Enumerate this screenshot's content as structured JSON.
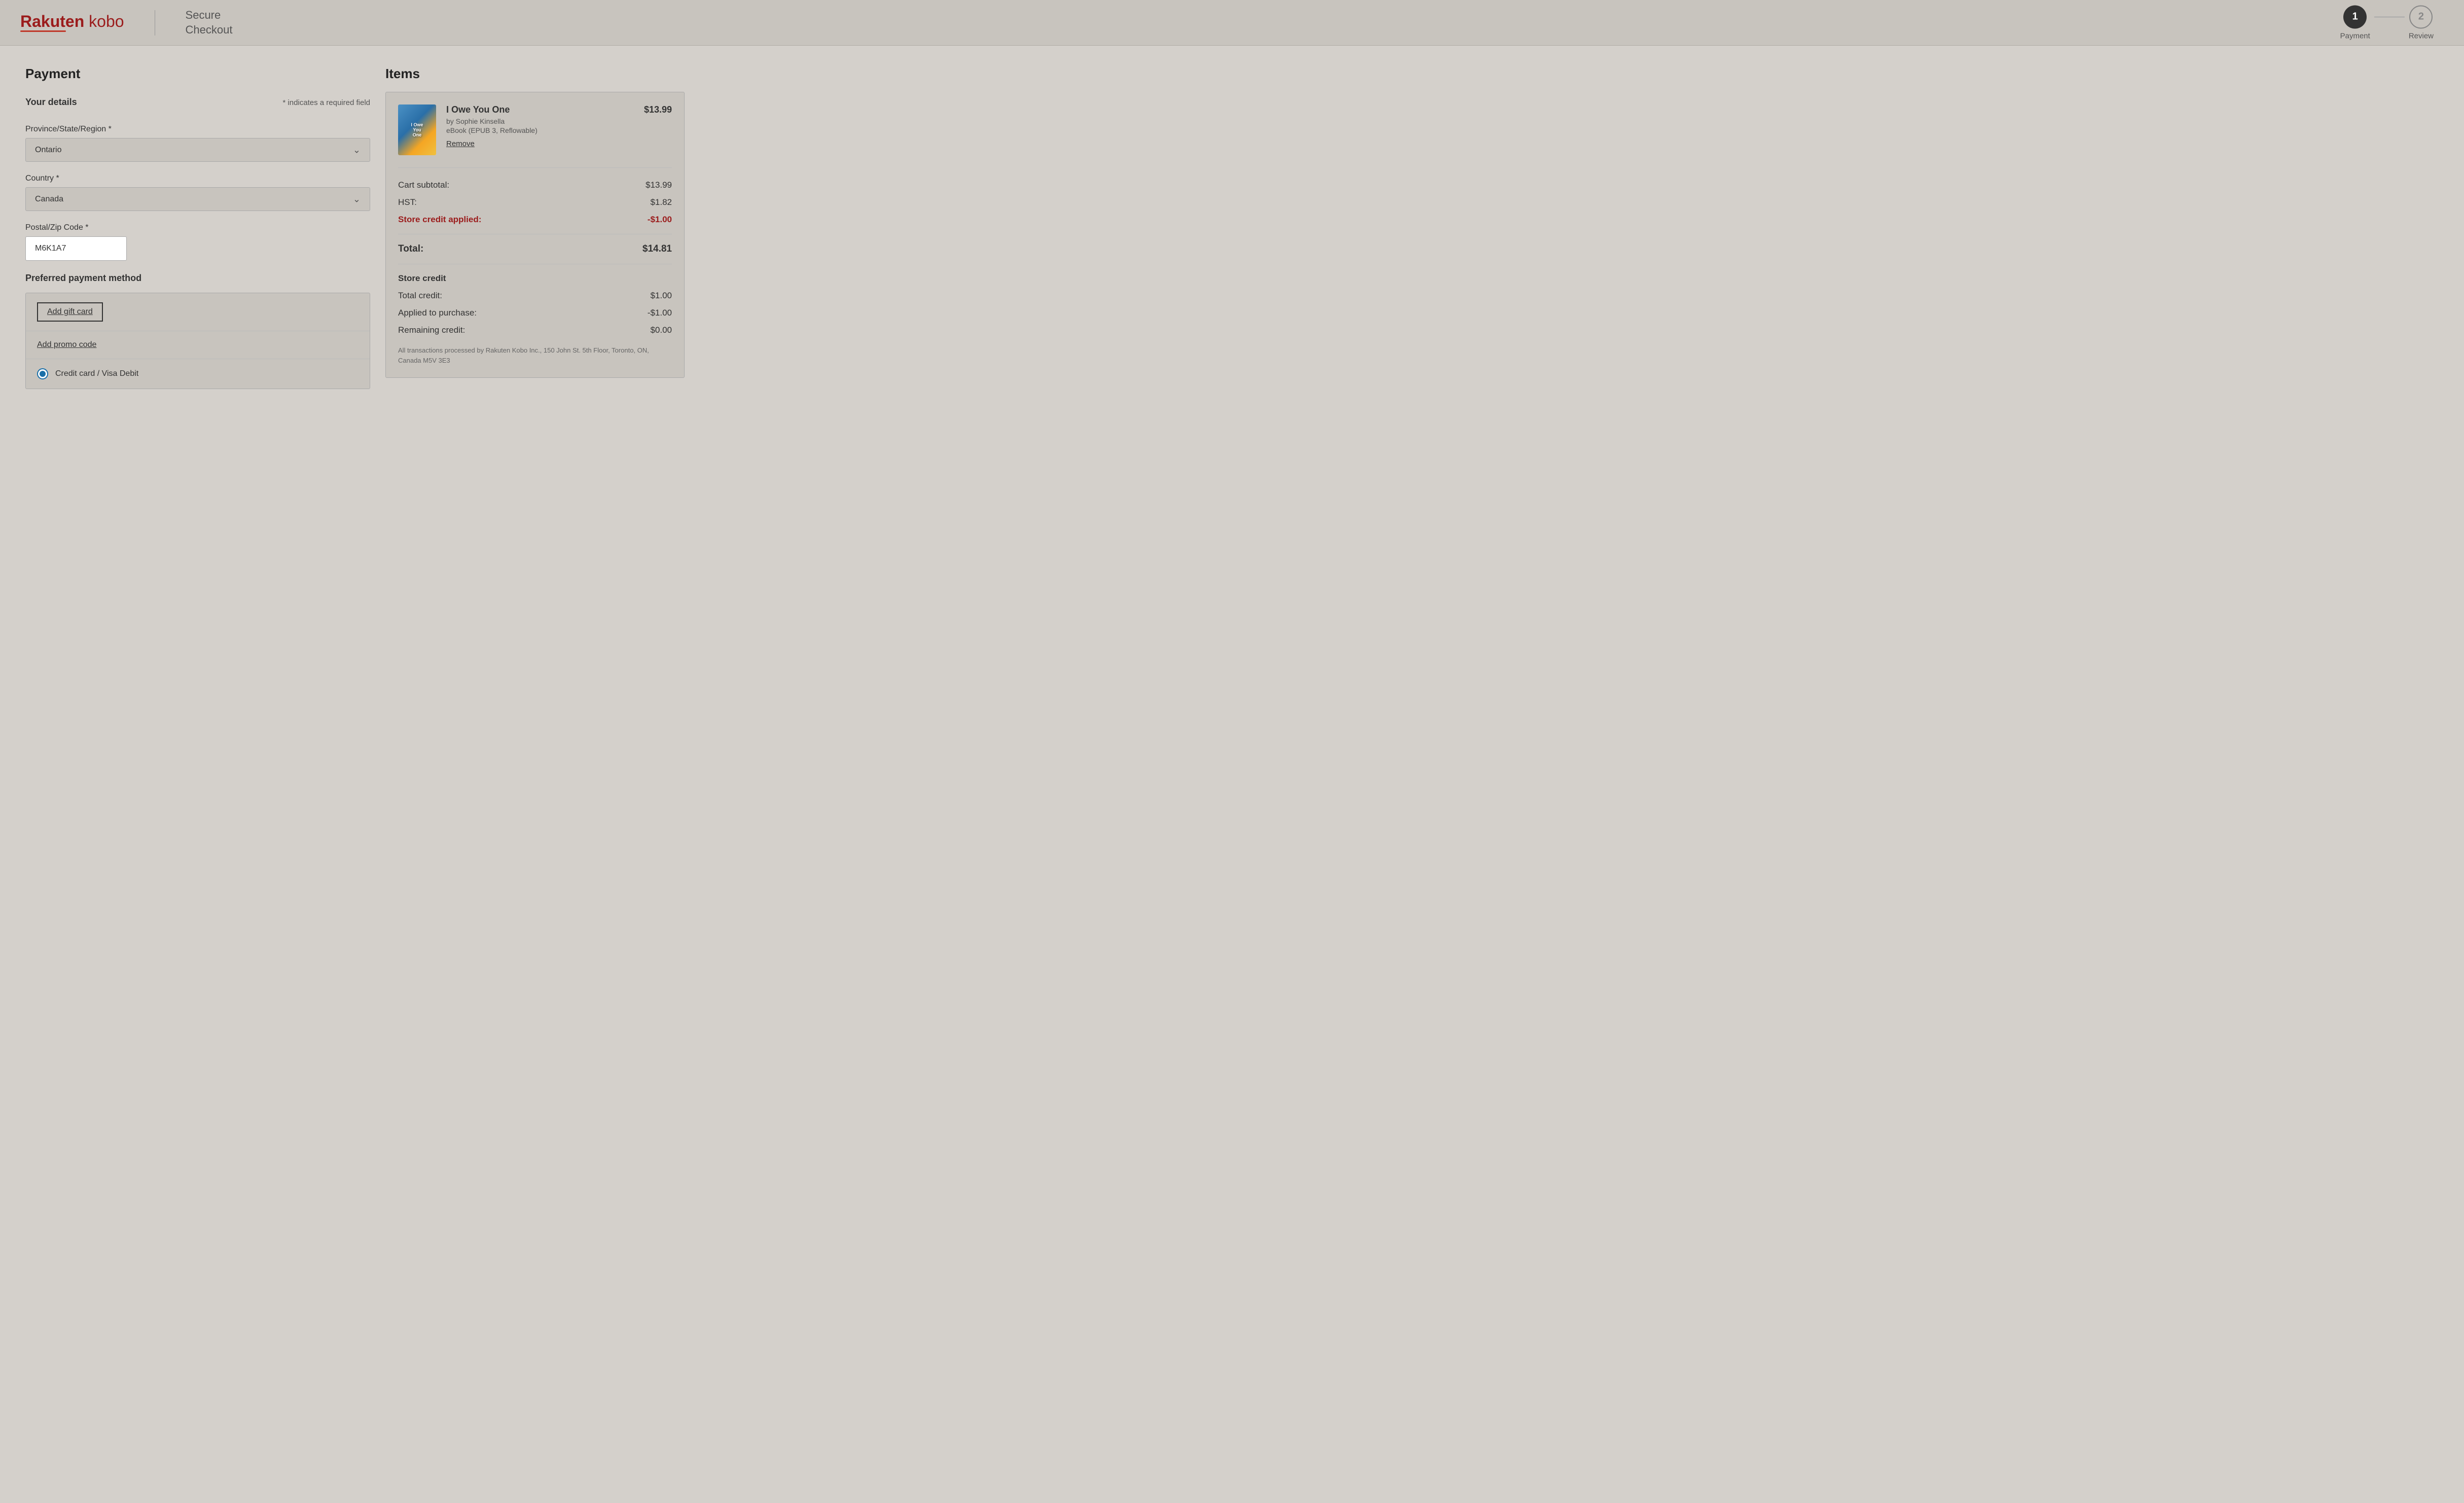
{
  "header": {
    "logo_rakuten": "Rakuten",
    "logo_kobo": "kobo",
    "secure_checkout": "Secure\nCheckout",
    "steps": [
      {
        "number": "1",
        "label": "Payment",
        "active": true
      },
      {
        "number": "2",
        "label": "Review",
        "active": false
      }
    ]
  },
  "payment": {
    "section_title": "Payment",
    "your_details_label": "Your details",
    "required_note": "* indicates a required field",
    "province_label": "Province/State/Region *",
    "province_value": "Ontario",
    "country_label": "Country *",
    "country_value": "Canada",
    "postal_label": "Postal/Zip Code *",
    "postal_value": "M6K1A7",
    "preferred_payment_label": "Preferred payment method",
    "add_gift_card": "Add gift card",
    "add_promo_code": "Add promo code",
    "credit_card_label": "Credit card / Visa Debit"
  },
  "items": {
    "section_title": "Items",
    "cart_item": {
      "title": "I Owe You One",
      "author": "by Sophie Kinsella",
      "format": "eBook (EPUB 3, Reflowable)",
      "price": "$13.99",
      "remove_label": "Remove",
      "cover_text": "I Owe\nYou\nOne"
    },
    "cart_subtotal_label": "Cart subtotal:",
    "cart_subtotal_value": "$13.99",
    "hst_label": "HST:",
    "hst_value": "$1.82",
    "store_credit_applied_label": "Store credit applied:",
    "store_credit_applied_value": "-$1.00",
    "total_label": "Total:",
    "total_value": "$14.81",
    "store_credit_title": "Store credit",
    "total_credit_label": "Total credit:",
    "total_credit_value": "$1.00",
    "applied_label": "Applied to purchase:",
    "applied_value": "-$1.00",
    "remaining_label": "Remaining credit:",
    "remaining_value": "$0.00",
    "transactions_note": "All transactions processed by Rakuten Kobo Inc., 150 John St. 5th Floor, Toronto, ON, Canada M5V 3E3"
  },
  "colors": {
    "brand_red": "#9b1c1c",
    "credit_red": "#9b1c1c",
    "step_active_bg": "#333333",
    "step_inactive_border": "#888888"
  }
}
